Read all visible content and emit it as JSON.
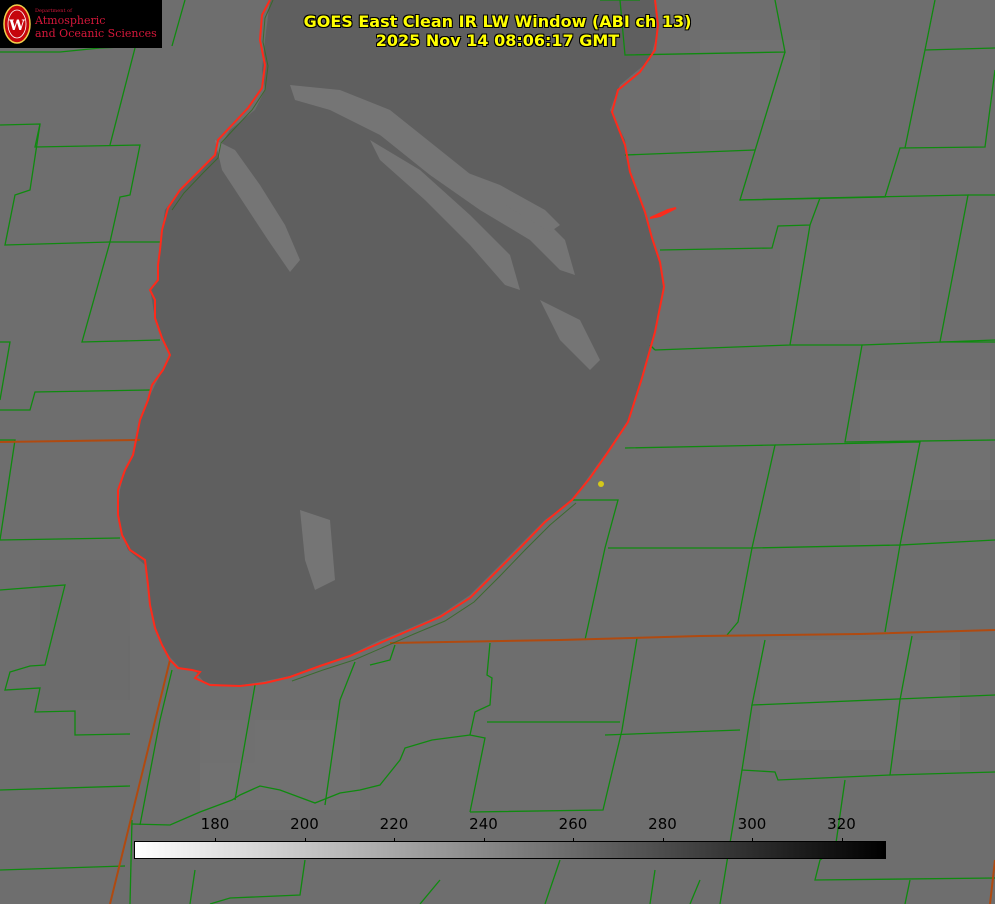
{
  "title": {
    "line1": "GOES East Clean IR LW Window (ABI ch 13)",
    "line2": "2025 Nov 14 08:06:17 GMT"
  },
  "logo": {
    "dept_text": "Department of",
    "line1": "Atmospheric",
    "line2": "and Oceanic Sciences",
    "seal_letter": "W"
  },
  "colorbar": {
    "ticks": [
      "180",
      "200",
      "220",
      "240",
      "260",
      "280",
      "300",
      "320"
    ],
    "gradient_from": "#ffffff",
    "gradient_to": "#000000"
  },
  "colors": {
    "background": "#6e6e6e",
    "lake": "#5f5f5f",
    "county_lines": "#0f8a0f",
    "state_lines": "#b04a10",
    "coastline": "#ff2a1a",
    "title_text": "#ffff00",
    "station_marker": "#d4c81a",
    "logo_text": "#d4173a"
  }
}
